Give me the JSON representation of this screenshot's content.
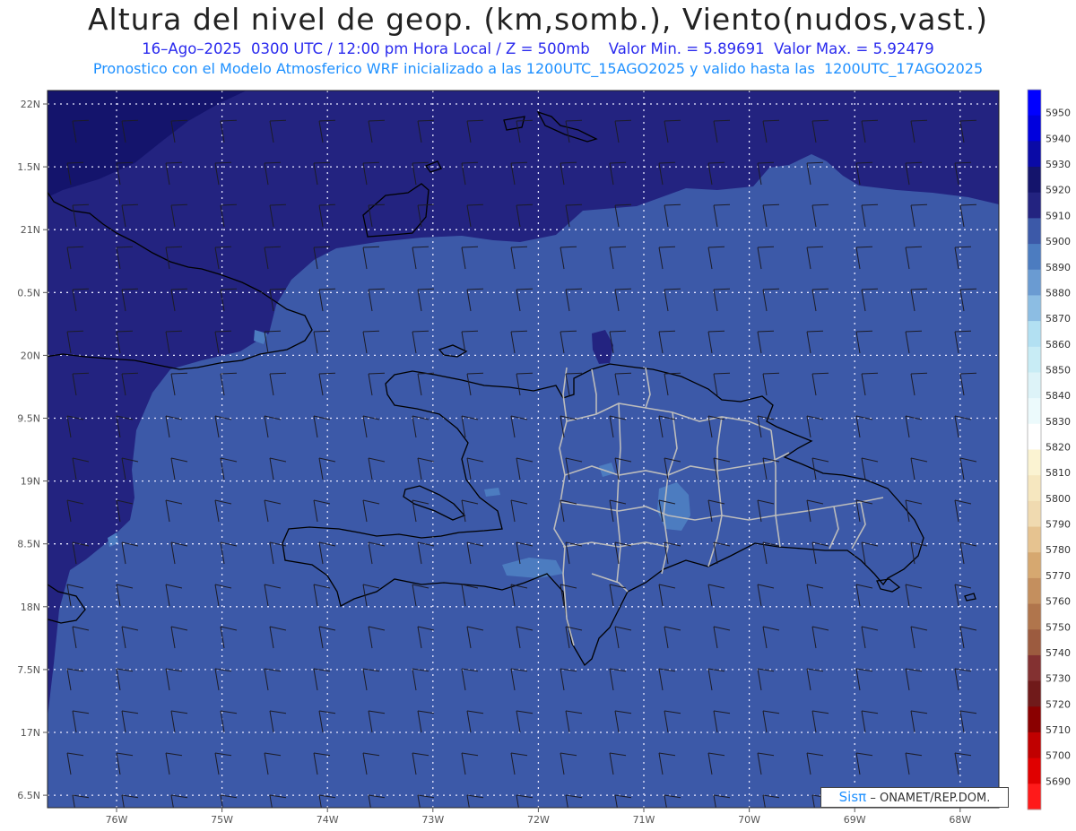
{
  "header": {
    "title": "Altura del nivel de geop. (km,somb.), Viento(nudos,vast.)",
    "subtitle": "16–Ago–2025  0300 UTC / 12:00 pm Hora Local / Z = 500mb    Valor Min. = 5.89691  Valor Max. = 5.92479",
    "model_line": "Pronostico con el Modelo Atmosferico WRF inicializado a las 1200UTC_15AGO2025 y valido hasta las  1200UTC_17AGO2025"
  },
  "axes": {
    "lon_labels": [
      "76W",
      "75W",
      "74W",
      "73W",
      "72W",
      "71W",
      "70W",
      "69W",
      "68W"
    ],
    "lat_labels": [
      "22N",
      "1.5N",
      "21N",
      "0.5N",
      "20N",
      "9.5N",
      "19N",
      "8.5N",
      "18N",
      "7.5N",
      "17N",
      "6.5N"
    ]
  },
  "colorbar": {
    "levels": [
      5950,
      5940,
      5930,
      5920,
      5910,
      5900,
      5890,
      5880,
      5870,
      5860,
      5850,
      5840,
      5830,
      5820,
      5810,
      5800,
      5790,
      5780,
      5770,
      5760,
      5750,
      5740,
      5730,
      5720,
      5710,
      5700,
      5690
    ],
    "colors": [
      "#0000ff",
      "#0000dd",
      "#0a0aa6",
      "#14146c",
      "#232380",
      "#3c59a8",
      "#4c7cc0",
      "#6a9bd2",
      "#8cbde3",
      "#b2e0f2",
      "#c8ecf5",
      "#ddf3f8",
      "#ecfafc",
      "#ffffff",
      "#fbf3d2",
      "#f6e7bf",
      "#f0dab0",
      "#e6c390",
      "#d6a870",
      "#c48f5e",
      "#b0754c",
      "#9c5b3f",
      "#833131",
      "#701a1a",
      "#8a0000",
      "#c00000",
      "#e00000",
      "#ff1a1a"
    ]
  },
  "map_colors": {
    "field_5900": "#3c59a8",
    "field_5910": "#232380",
    "field_5920": "#14146c",
    "field_5890": "#4c7cc0",
    "grid": "#e8e8ff",
    "coast": "#000000",
    "provinces": "#bcbcbc"
  },
  "credit": {
    "logo": "Sisπ",
    "text": "– ONAMET/REP.DOM."
  }
}
